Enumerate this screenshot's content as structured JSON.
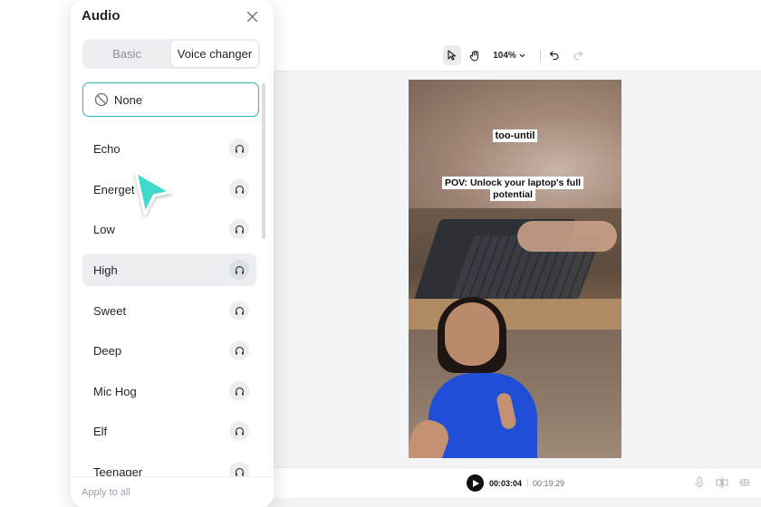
{
  "toolbar": {
    "zoom_label": "104%",
    "tools": [
      "select-icon",
      "hand-icon",
      "undo-icon",
      "redo-icon"
    ]
  },
  "video": {
    "caption_top": "too-until",
    "caption_main": "POV: Unlock your laptop's full potential"
  },
  "timeline": {
    "current_time": "00:03:04",
    "separator": "|",
    "total_time": "00:19:29"
  },
  "panel": {
    "title": "Audio",
    "tabs": [
      {
        "label": "Basic",
        "selected": false
      },
      {
        "label": "Voice changer",
        "selected": true
      }
    ],
    "none_label": "None",
    "items": [
      {
        "label": "Echo"
      },
      {
        "label": "Energet"
      },
      {
        "label": "Low"
      },
      {
        "label": "High",
        "active": true
      },
      {
        "label": "Sweet"
      },
      {
        "label": "Deep"
      },
      {
        "label": "Mic Hog"
      },
      {
        "label": "Elf"
      },
      {
        "label": "Teenager"
      }
    ],
    "footer_label": "Apply to all"
  },
  "colors": {
    "accent": "#2bb3b1",
    "cursor": "#3fd9c9",
    "active_bg": "#eceef1"
  }
}
